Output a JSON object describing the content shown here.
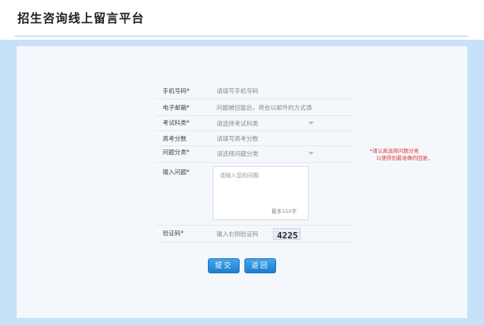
{
  "header": {
    "title": "招生咨询线上留言平台"
  },
  "form": {
    "phone": {
      "label": "手机号码*",
      "placeholder": "请填写手机号码"
    },
    "email": {
      "label": "电子邮箱*",
      "placeholder": "问题被回复后，将会以邮件的方式通"
    },
    "exam_category": {
      "label": "考试科类*",
      "selected": "请选择考试科类"
    },
    "score": {
      "label": "高考分数",
      "placeholder": "请填写高考分数"
    },
    "question_category": {
      "label": "问题分类*",
      "selected": "请选择问题分类"
    },
    "question": {
      "label": "输入问题*",
      "placeholder": "请输入您的问题",
      "counter": "最多150字"
    },
    "captcha": {
      "label": "验证码*",
      "placeholder": "输入右侧验证码",
      "image_text": "4225"
    }
  },
  "note": {
    "line1": "*请认真选择问题分类",
    "line2": "以便得到最准确的回复。"
  },
  "buttons": {
    "submit": "提交",
    "back": "返回"
  },
  "colors": {
    "accent": "#1d7fcf",
    "note": "#e23b3b",
    "outer_bg": "#c7e2f8"
  }
}
